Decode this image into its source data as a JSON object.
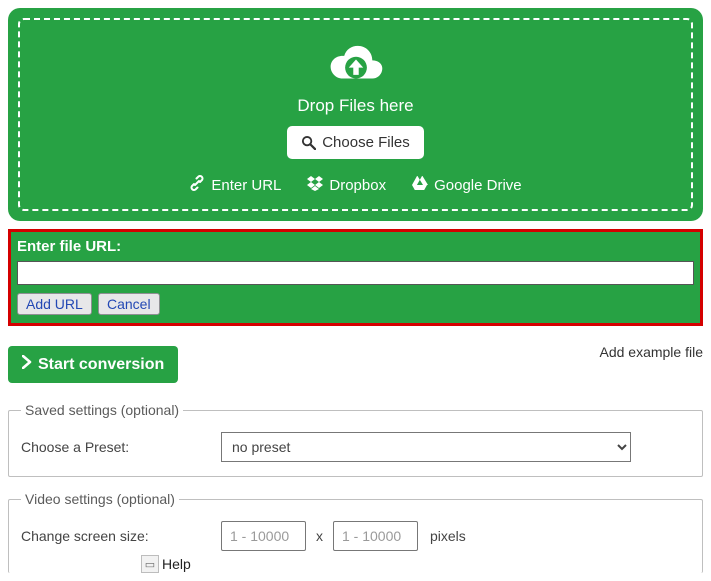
{
  "dropzone": {
    "drop_text": "Drop Files here",
    "choose_label": "Choose Files",
    "sources": {
      "url": "Enter URL",
      "dropbox": "Dropbox",
      "gdrive": "Google Drive"
    }
  },
  "url_panel": {
    "label": "Enter file URL:",
    "value": "",
    "add_label": "Add URL",
    "cancel_label": "Cancel"
  },
  "actions": {
    "start_label": "Start conversion",
    "example_label": "Add example file"
  },
  "saved_settings": {
    "legend": "Saved settings (optional)",
    "preset_label": "Choose a Preset:",
    "preset_value": "no preset"
  },
  "video_settings": {
    "legend": "Video settings (optional)",
    "size_label": "Change screen size:",
    "dim_placeholder": "1 - 10000",
    "x": "x",
    "pixels": "pixels",
    "help": "Help"
  }
}
